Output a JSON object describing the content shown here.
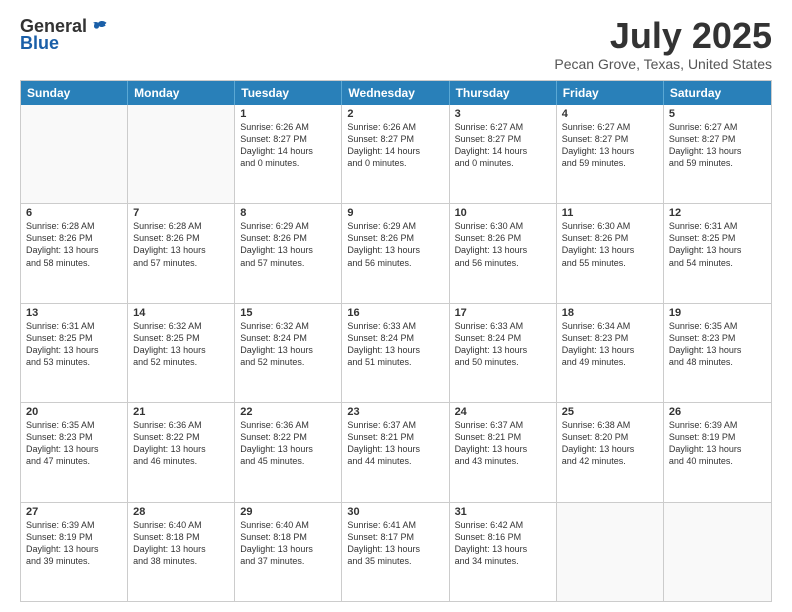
{
  "header": {
    "logo_general": "General",
    "logo_blue": "Blue",
    "title": "July 2025",
    "subtitle": "Pecan Grove, Texas, United States"
  },
  "days": [
    "Sunday",
    "Monday",
    "Tuesday",
    "Wednesday",
    "Thursday",
    "Friday",
    "Saturday"
  ],
  "weeks": [
    [
      {
        "day": "",
        "empty": true
      },
      {
        "day": "",
        "empty": true
      },
      {
        "day": "1",
        "line1": "Sunrise: 6:26 AM",
        "line2": "Sunset: 8:27 PM",
        "line3": "Daylight: 14 hours",
        "line4": "and 0 minutes."
      },
      {
        "day": "2",
        "line1": "Sunrise: 6:26 AM",
        "line2": "Sunset: 8:27 PM",
        "line3": "Daylight: 14 hours",
        "line4": "and 0 minutes."
      },
      {
        "day": "3",
        "line1": "Sunrise: 6:27 AM",
        "line2": "Sunset: 8:27 PM",
        "line3": "Daylight: 14 hours",
        "line4": "and 0 minutes."
      },
      {
        "day": "4",
        "line1": "Sunrise: 6:27 AM",
        "line2": "Sunset: 8:27 PM",
        "line3": "Daylight: 13 hours",
        "line4": "and 59 minutes."
      },
      {
        "day": "5",
        "line1": "Sunrise: 6:27 AM",
        "line2": "Sunset: 8:27 PM",
        "line3": "Daylight: 13 hours",
        "line4": "and 59 minutes."
      }
    ],
    [
      {
        "day": "6",
        "line1": "Sunrise: 6:28 AM",
        "line2": "Sunset: 8:26 PM",
        "line3": "Daylight: 13 hours",
        "line4": "and 58 minutes."
      },
      {
        "day": "7",
        "line1": "Sunrise: 6:28 AM",
        "line2": "Sunset: 8:26 PM",
        "line3": "Daylight: 13 hours",
        "line4": "and 57 minutes."
      },
      {
        "day": "8",
        "line1": "Sunrise: 6:29 AM",
        "line2": "Sunset: 8:26 PM",
        "line3": "Daylight: 13 hours",
        "line4": "and 57 minutes."
      },
      {
        "day": "9",
        "line1": "Sunrise: 6:29 AM",
        "line2": "Sunset: 8:26 PM",
        "line3": "Daylight: 13 hours",
        "line4": "and 56 minutes."
      },
      {
        "day": "10",
        "line1": "Sunrise: 6:30 AM",
        "line2": "Sunset: 8:26 PM",
        "line3": "Daylight: 13 hours",
        "line4": "and 56 minutes."
      },
      {
        "day": "11",
        "line1": "Sunrise: 6:30 AM",
        "line2": "Sunset: 8:26 PM",
        "line3": "Daylight: 13 hours",
        "line4": "and 55 minutes."
      },
      {
        "day": "12",
        "line1": "Sunrise: 6:31 AM",
        "line2": "Sunset: 8:25 PM",
        "line3": "Daylight: 13 hours",
        "line4": "and 54 minutes."
      }
    ],
    [
      {
        "day": "13",
        "line1": "Sunrise: 6:31 AM",
        "line2": "Sunset: 8:25 PM",
        "line3": "Daylight: 13 hours",
        "line4": "and 53 minutes."
      },
      {
        "day": "14",
        "line1": "Sunrise: 6:32 AM",
        "line2": "Sunset: 8:25 PM",
        "line3": "Daylight: 13 hours",
        "line4": "and 52 minutes."
      },
      {
        "day": "15",
        "line1": "Sunrise: 6:32 AM",
        "line2": "Sunset: 8:24 PM",
        "line3": "Daylight: 13 hours",
        "line4": "and 52 minutes."
      },
      {
        "day": "16",
        "line1": "Sunrise: 6:33 AM",
        "line2": "Sunset: 8:24 PM",
        "line3": "Daylight: 13 hours",
        "line4": "and 51 minutes."
      },
      {
        "day": "17",
        "line1": "Sunrise: 6:33 AM",
        "line2": "Sunset: 8:24 PM",
        "line3": "Daylight: 13 hours",
        "line4": "and 50 minutes."
      },
      {
        "day": "18",
        "line1": "Sunrise: 6:34 AM",
        "line2": "Sunset: 8:23 PM",
        "line3": "Daylight: 13 hours",
        "line4": "and 49 minutes."
      },
      {
        "day": "19",
        "line1": "Sunrise: 6:35 AM",
        "line2": "Sunset: 8:23 PM",
        "line3": "Daylight: 13 hours",
        "line4": "and 48 minutes."
      }
    ],
    [
      {
        "day": "20",
        "line1": "Sunrise: 6:35 AM",
        "line2": "Sunset: 8:23 PM",
        "line3": "Daylight: 13 hours",
        "line4": "and 47 minutes."
      },
      {
        "day": "21",
        "line1": "Sunrise: 6:36 AM",
        "line2": "Sunset: 8:22 PM",
        "line3": "Daylight: 13 hours",
        "line4": "and 46 minutes."
      },
      {
        "day": "22",
        "line1": "Sunrise: 6:36 AM",
        "line2": "Sunset: 8:22 PM",
        "line3": "Daylight: 13 hours",
        "line4": "and 45 minutes."
      },
      {
        "day": "23",
        "line1": "Sunrise: 6:37 AM",
        "line2": "Sunset: 8:21 PM",
        "line3": "Daylight: 13 hours",
        "line4": "and 44 minutes."
      },
      {
        "day": "24",
        "line1": "Sunrise: 6:37 AM",
        "line2": "Sunset: 8:21 PM",
        "line3": "Daylight: 13 hours",
        "line4": "and 43 minutes."
      },
      {
        "day": "25",
        "line1": "Sunrise: 6:38 AM",
        "line2": "Sunset: 8:20 PM",
        "line3": "Daylight: 13 hours",
        "line4": "and 42 minutes."
      },
      {
        "day": "26",
        "line1": "Sunrise: 6:39 AM",
        "line2": "Sunset: 8:19 PM",
        "line3": "Daylight: 13 hours",
        "line4": "and 40 minutes."
      }
    ],
    [
      {
        "day": "27",
        "line1": "Sunrise: 6:39 AM",
        "line2": "Sunset: 8:19 PM",
        "line3": "Daylight: 13 hours",
        "line4": "and 39 minutes."
      },
      {
        "day": "28",
        "line1": "Sunrise: 6:40 AM",
        "line2": "Sunset: 8:18 PM",
        "line3": "Daylight: 13 hours",
        "line4": "and 38 minutes."
      },
      {
        "day": "29",
        "line1": "Sunrise: 6:40 AM",
        "line2": "Sunset: 8:18 PM",
        "line3": "Daylight: 13 hours",
        "line4": "and 37 minutes."
      },
      {
        "day": "30",
        "line1": "Sunrise: 6:41 AM",
        "line2": "Sunset: 8:17 PM",
        "line3": "Daylight: 13 hours",
        "line4": "and 35 minutes."
      },
      {
        "day": "31",
        "line1": "Sunrise: 6:42 AM",
        "line2": "Sunset: 8:16 PM",
        "line3": "Daylight: 13 hours",
        "line4": "and 34 minutes."
      },
      {
        "day": "",
        "empty": true
      },
      {
        "day": "",
        "empty": true
      }
    ]
  ]
}
